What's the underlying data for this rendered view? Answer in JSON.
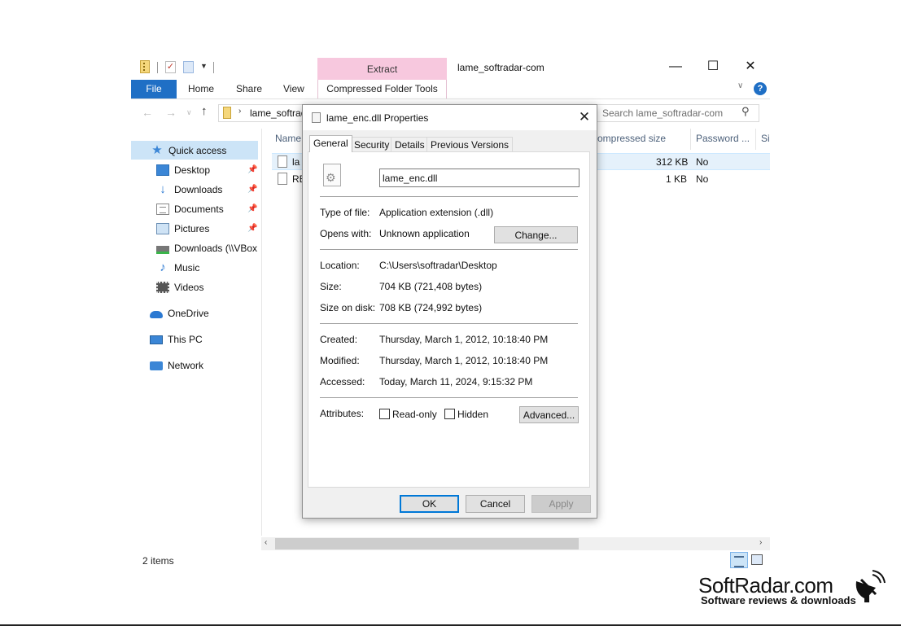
{
  "window": {
    "title": "lame_softradar-com",
    "contextual_tab": "Extract",
    "minimize": "—",
    "maximize": "☐",
    "close": "✕"
  },
  "ribbon": {
    "tabs": [
      "File",
      "Home",
      "Share",
      "View"
    ],
    "contextual_group": "Compressed Folder Tools",
    "help": "?"
  },
  "address": {
    "path": "lame_softradar-com",
    "search_placeholder": "Search lame_softradar-com"
  },
  "sidebar": {
    "items": [
      {
        "label": "Quick access",
        "icon": "star-icon"
      },
      {
        "label": "Desktop",
        "icon": "desktop-icon",
        "pinned": true
      },
      {
        "label": "Downloads",
        "icon": "download-icon",
        "pinned": true
      },
      {
        "label": "Documents",
        "icon": "documents-icon",
        "pinned": true
      },
      {
        "label": "Pictures",
        "icon": "pictures-icon",
        "pinned": true
      },
      {
        "label": "Downloads (\\\\VBox",
        "icon": "network-drive-icon"
      },
      {
        "label": "Music",
        "icon": "music-icon"
      },
      {
        "label": "Videos",
        "icon": "videos-icon"
      },
      {
        "label": "OneDrive",
        "icon": "cloud-icon"
      },
      {
        "label": "This PC",
        "icon": "computer-icon"
      },
      {
        "label": "Network",
        "icon": "network-icon"
      }
    ]
  },
  "file_list": {
    "columns": [
      "Name",
      "ompressed size",
      "Password ...",
      "Si"
    ],
    "rows": [
      {
        "name": "la",
        "compressed_size": "312 KB",
        "password": "No"
      },
      {
        "name": "RE",
        "compressed_size": "1 KB",
        "password": "No"
      }
    ]
  },
  "status": {
    "item_count": "2 items"
  },
  "dialog": {
    "title": "lame_enc.dll Properties",
    "close": "✕",
    "tabs": [
      "General",
      "Security",
      "Details",
      "Previous Versions"
    ],
    "active_tab": "General",
    "file_name": "lame_enc.dll",
    "type_label": "Type of file:",
    "type_value": "Application extension (.dll)",
    "opens_label": "Opens with:",
    "opens_value": "Unknown application",
    "change_button": "Change...",
    "location_label": "Location:",
    "location_value": "C:\\Users\\softradar\\Desktop",
    "size_label": "Size:",
    "size_value": "704 KB (721,408 bytes)",
    "size_disk_label": "Size on disk:",
    "size_disk_value": "708 KB (724,992 bytes)",
    "created_label": "Created:",
    "created_value": "Thursday, March 1, 2012, 10:18:40 PM",
    "modified_label": "Modified:",
    "modified_value": "Thursday, March 1, 2012, 10:18:40 PM",
    "accessed_label": "Accessed:",
    "accessed_value": "Today, March 11, 2024, 9:15:32 PM",
    "attributes_label": "Attributes:",
    "readonly_label": "Read-only",
    "hidden_label": "Hidden",
    "advanced_button": "Advanced...",
    "ok_button": "OK",
    "cancel_button": "Cancel",
    "apply_button": "Apply"
  },
  "watermark": {
    "name": "SoftRadar.com",
    "tagline": "Software reviews & downloads"
  },
  "colors": {
    "accent": "#1f6fc5",
    "extract_tab": "#f7c8de",
    "selection": "#cce4f7"
  }
}
